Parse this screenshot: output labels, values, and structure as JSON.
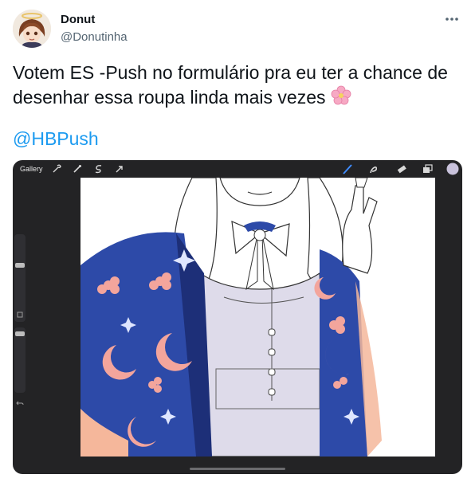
{
  "tweet": {
    "author": {
      "display_name": "Donut",
      "handle": "@Donutinha"
    },
    "text": "Votem ES -Push no formulário pra eu ter a chance de desenhar essa roupa linda mais vezes",
    "emoji": "🌸",
    "mention": "@HBPush",
    "icons": {
      "more": "more-horizontal-icon",
      "emoji": "cherry-blossom"
    }
  },
  "media": {
    "app_toolbar": {
      "gallery_label": "Gallery",
      "tools_left": [
        "wrench-icon",
        "magic-wand-icon",
        "selection-icon",
        "transform-arrow-icon"
      ],
      "tools_right": [
        "brush-icon",
        "smudge-icon",
        "eraser-icon",
        "layers-icon",
        "color-swatch"
      ]
    },
    "colors": {
      "accent": "#1d9bf0",
      "jacket": "#2d4aa8",
      "pattern": "#f3a59c",
      "skin_shadow": "#e4e1ef"
    }
  }
}
